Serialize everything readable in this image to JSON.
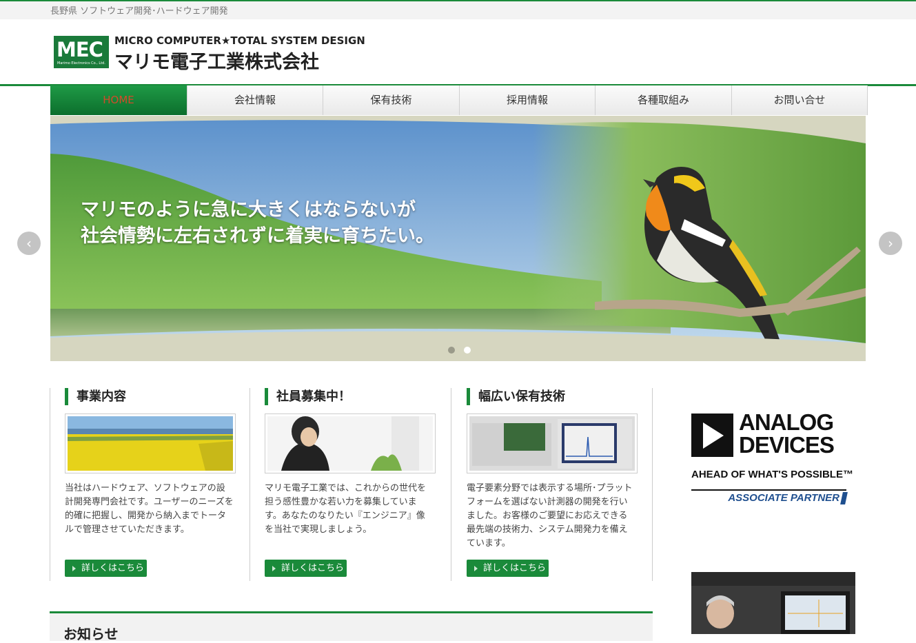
{
  "topbar": {
    "tagline": "長野県 ソフトウェア開発･ハードウェア開発"
  },
  "logo": {
    "mark": "MEC",
    "mark_small": "Marimo Electronics Co., Ltd.",
    "english": "MICRO COMPUTER★TOTAL SYSTEM DESIGN",
    "japanese": "マリモ電子工業株式会社"
  },
  "nav": {
    "items": [
      {
        "label": "HOME",
        "active": true
      },
      {
        "label": "会社情報"
      },
      {
        "label": "保有技術"
      },
      {
        "label": "採用情報"
      },
      {
        "label": "各種取組み"
      },
      {
        "label": "お問い合せ"
      }
    ]
  },
  "hero": {
    "line1": "マリモのように急に大きくはならないが",
    "line2": "社会情勢に左右されずに着実に育ちたい。",
    "prev": "‹",
    "next": "›",
    "slide_count": 2,
    "active_slide": 2
  },
  "columns": [
    {
      "title": "事業内容",
      "text": "当社はハードウェア、ソフトウェアの設計開発専門会社です。ユーザーのニーズを的確に把握し、開発から納入までトータルで管理させていただきます。",
      "button": "詳しくはこちら"
    },
    {
      "title": "社員募集中！",
      "text": "マリモ電子工業では、これからの世代を担う感性豊かな若い力を募集しています。あなたのなりたい『エンジニア』像を当社で実現しましょう。",
      "button": "詳しくはこちら"
    },
    {
      "title": "幅広い保有技術",
      "text": "電子要素分野では表示する場所･プラットフォームを選ばない計測器の開発を行いました。お客様のご要望にお応えできる最先端の技術力、システム開発力を備えています。",
      "button": "詳しくはこちら"
    }
  ],
  "news": {
    "title": "お知らせ"
  },
  "sidebar": {
    "adi_name_line1": "ANALOG",
    "adi_name_line2": "DEVICES",
    "adi_tagline": "AHEAD OF WHAT'S POSSIBLE™",
    "adi_partner": "ASSOCIATE PARTNER"
  },
  "colors": {
    "brand_green": "#1a8a3a",
    "partner_blue": "#1f4f8f",
    "nav_active_text": "#d24a2a"
  }
}
